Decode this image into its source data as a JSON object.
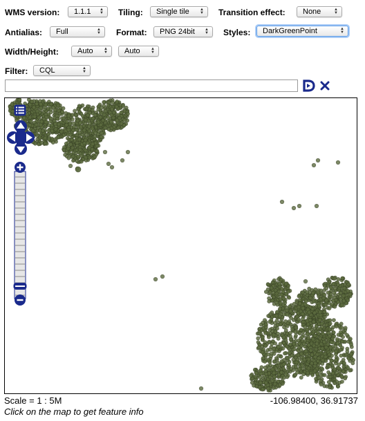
{
  "toolbar": {
    "wms_version": {
      "label": "WMS version:",
      "value": "1.1.1"
    },
    "tiling": {
      "label": "Tiling:",
      "value": "Single tile"
    },
    "transition": {
      "label": "Transition effect:",
      "value": "None"
    },
    "antialias": {
      "label": "Antialias:",
      "value": "Full"
    },
    "format": {
      "label": "Format:",
      "value": "PNG 24bit"
    },
    "styles": {
      "label": "Styles:",
      "value": "DarkGreenPoint"
    },
    "size": {
      "label": "Width/Height:",
      "width_value": "Auto",
      "height_value": "Auto"
    },
    "filter": {
      "label": "Filter:",
      "type_value": "CQL",
      "text_value": ""
    }
  },
  "map": {
    "point_color": "#5c6b3f",
    "point_stroke": "#3a4426",
    "nav_color": "#1a2a8c"
  },
  "status": {
    "scale": "Scale = 1 : 5M",
    "coordinates": "-106.98400, 36.91737",
    "hint": "Click on the map to get feature info"
  },
  "icons": {
    "apply": "play-icon",
    "clear": "close-icon",
    "layer_switcher": "layer-switcher-icon",
    "pan": "pan-arrows-icon",
    "zoom_in": "zoom-in-icon",
    "zoom_out": "zoom-out-icon"
  }
}
